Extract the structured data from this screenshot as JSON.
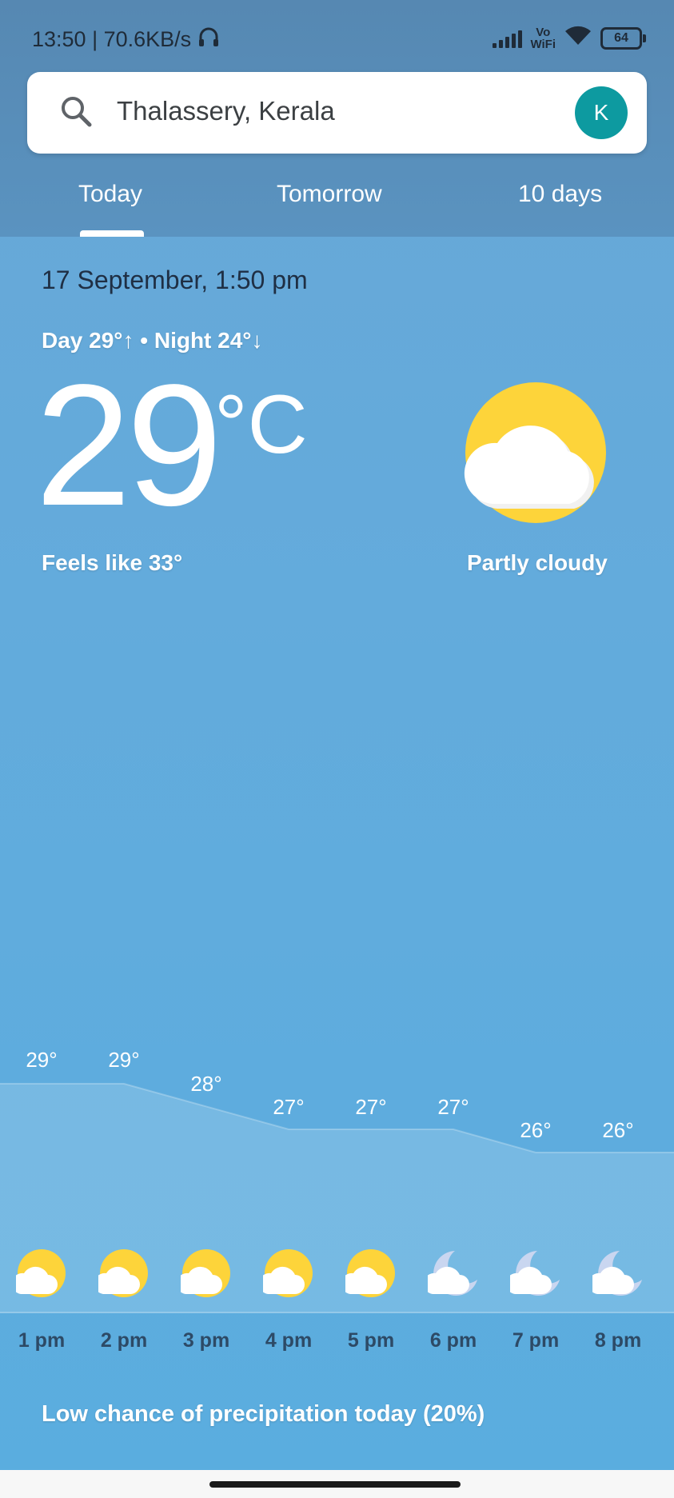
{
  "status_bar": {
    "time_speed": "13:50 | 70.6KB/s",
    "vowifi_top": "Vo",
    "vowifi_bottom": "WiFi",
    "battery": "64"
  },
  "search": {
    "location": "Thalassery, Kerala",
    "avatar_letter": "K"
  },
  "tabs": [
    {
      "label": "Today",
      "selected": true
    },
    {
      "label": "Tomorrow",
      "selected": false
    },
    {
      "label": "10 days",
      "selected": false
    }
  ],
  "current": {
    "datetime": "17 September, 1:50 pm",
    "day_night": "Day 29°↑ • Night 24°↓",
    "temperature": "29",
    "unit": "°C",
    "feels_like": "Feels like 33°",
    "condition": "Partly cloudy",
    "icon": "partly-cloudy-icon"
  },
  "hourly": [
    {
      "time": "1 pm",
      "temp": "29°",
      "icon": "partly-cloudy-day"
    },
    {
      "time": "2 pm",
      "temp": "29°",
      "icon": "partly-cloudy-day"
    },
    {
      "time": "3 pm",
      "temp": "28°",
      "icon": "partly-cloudy-day"
    },
    {
      "time": "4 pm",
      "temp": "27°",
      "icon": "partly-cloudy-day"
    },
    {
      "time": "5 pm",
      "temp": "27°",
      "icon": "partly-cloudy-day"
    },
    {
      "time": "6 pm",
      "temp": "27°",
      "icon": "partly-cloudy-night"
    },
    {
      "time": "7 pm",
      "temp": "26°",
      "icon": "partly-cloudy-night"
    },
    {
      "time": "8 pm",
      "temp": "26°",
      "icon": "partly-cloudy-night"
    }
  ],
  "precipitation": "Low chance of precipitation today (20%)",
  "colors": {
    "sun": "#fdd43a",
    "avatar": "#0d9aa0",
    "header": "#5688b2"
  }
}
